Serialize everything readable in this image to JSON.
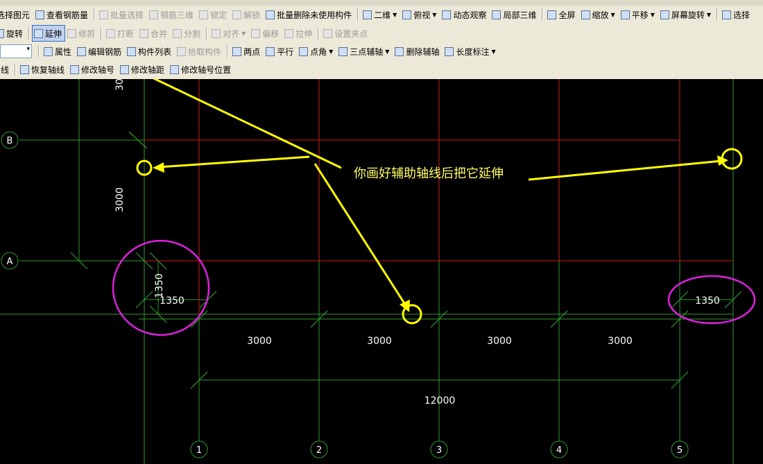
{
  "toolbar": {
    "row1": [
      {
        "label": "选择图元",
        "enabled": true
      },
      {
        "label": "查看钢筋量",
        "enabled": true
      },
      {
        "label": "批量选择",
        "enabled": false
      },
      {
        "label": "钢筋三维",
        "enabled": false
      },
      {
        "label": "锁定",
        "enabled": false
      },
      {
        "label": "解锁",
        "enabled": false
      },
      {
        "label": "批量删除未使用构件",
        "enabled": true
      },
      {
        "label": "二维",
        "enabled": true,
        "dropdown": true
      },
      {
        "label": "俯视",
        "enabled": true,
        "dropdown": true
      },
      {
        "label": "动态观察",
        "enabled": true
      },
      {
        "label": "局部三维",
        "enabled": true
      },
      {
        "label": "全屏",
        "enabled": true
      },
      {
        "label": "缩放",
        "enabled": true,
        "dropdown": true
      },
      {
        "label": "平移",
        "enabled": true,
        "dropdown": true
      },
      {
        "label": "屏幕旋转",
        "enabled": true,
        "dropdown": true
      },
      {
        "label": "选择",
        "enabled": true
      }
    ],
    "row2": [
      {
        "label": "旋转",
        "enabled": true
      },
      {
        "label": "延伸",
        "enabled": true,
        "active": true
      },
      {
        "label": "修剪",
        "enabled": false
      },
      {
        "label": "打断",
        "enabled": false
      },
      {
        "label": "合并",
        "enabled": false
      },
      {
        "label": "分割",
        "enabled": false
      },
      {
        "label": "对齐",
        "enabled": false,
        "dropdown": true
      },
      {
        "label": "偏移",
        "enabled": false
      },
      {
        "label": "拉伸",
        "enabled": false
      },
      {
        "label": "设置夹点",
        "enabled": false
      }
    ],
    "row3": [
      {
        "label": "属性",
        "enabled": true
      },
      {
        "label": "编辑钢筋",
        "enabled": true
      },
      {
        "label": "构件列表",
        "enabled": true
      },
      {
        "label": "拾取构件",
        "enabled": false
      },
      {
        "label": "两点",
        "enabled": true
      },
      {
        "label": "平行",
        "enabled": true
      },
      {
        "label": "点角",
        "enabled": true,
        "dropdown": true
      },
      {
        "label": "三点辅轴",
        "enabled": true,
        "dropdown": true
      },
      {
        "label": "删除辅轴",
        "enabled": true
      },
      {
        "label": "长度标注",
        "enabled": true,
        "dropdown": true
      }
    ],
    "row4": [
      {
        "label": "线",
        "enabled": true
      },
      {
        "label": "恢复轴线",
        "enabled": true
      },
      {
        "label": "修改轴号",
        "enabled": true
      },
      {
        "label": "修改轴距",
        "enabled": true
      },
      {
        "label": "修改轴号位置",
        "enabled": true
      }
    ]
  },
  "drawing": {
    "axis_labels_vertical": [
      "1",
      "2",
      "3",
      "4",
      "5"
    ],
    "axis_labels_horizontal": [
      "B",
      "A"
    ],
    "dim_spans": [
      "3000",
      "3000",
      "3000",
      "3000"
    ],
    "dim_total": "12000",
    "dim_left_vertical": "3000",
    "dim_top_vertical": "30",
    "dim_1350_left_vertical": "1350",
    "dim_1350_left": "1350",
    "dim_1350_right": "1350",
    "annotation": "你画好辅助轴线后把它延伸",
    "colors": {
      "axis": "#2f9a2f",
      "beam": "#d11a1a",
      "annotation": "#ffff00",
      "highlight": "#e020e0",
      "text": "#ffffff"
    }
  }
}
